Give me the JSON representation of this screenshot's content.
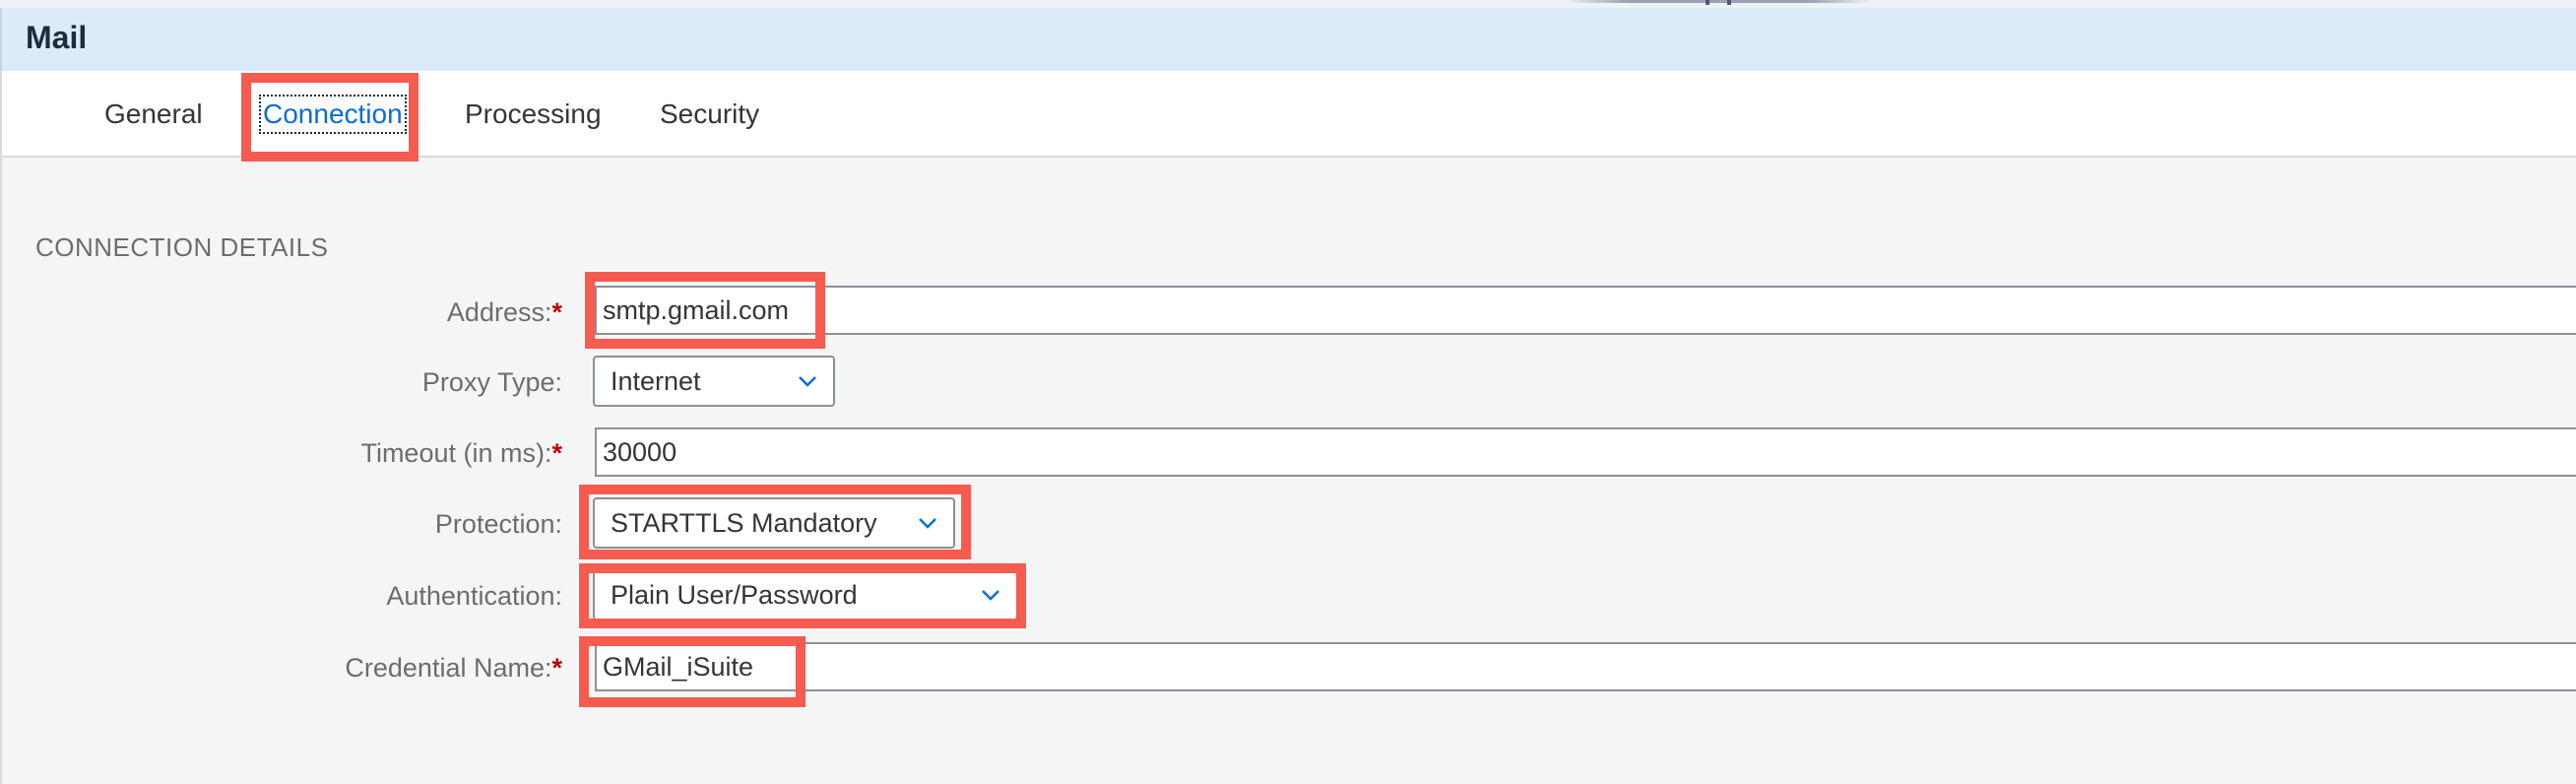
{
  "header": {
    "title": "Mail"
  },
  "tabs": [
    {
      "label": "General",
      "active": false
    },
    {
      "label": "Connection",
      "active": true
    },
    {
      "label": "Processing",
      "active": false
    },
    {
      "label": "Security",
      "active": false
    }
  ],
  "section": {
    "title": "CONNECTION DETAILS"
  },
  "form": {
    "address": {
      "label": "Address:",
      "required_mark": "*",
      "value": "smtp.gmail.com"
    },
    "proxy_type": {
      "label": "Proxy Type:",
      "value": "Internet"
    },
    "timeout": {
      "label": "Timeout (in ms):",
      "required_mark": "*",
      "value": "30000"
    },
    "protection": {
      "label": "Protection:",
      "value": "STARTTLS Mandatory"
    },
    "authentication": {
      "label": "Authentication:",
      "value": "Plain User/Password"
    },
    "credential_name": {
      "label": "Credential Name:",
      "required_mark": "*",
      "value": "GMail_iSuite"
    }
  },
  "icons": {
    "dropdown": "chevron-down-icon"
  },
  "colors": {
    "header_bg": "#dcebfa",
    "active_tab": "#0a6ed1",
    "required": "#bb0000",
    "highlight": "#f65b50"
  }
}
